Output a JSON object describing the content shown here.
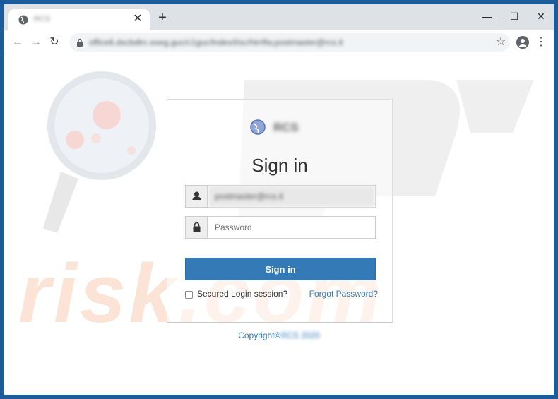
{
  "browser": {
    "tab_title": "RCS",
    "new_tab_label": "+",
    "tab_close_label": "✕",
    "url": "office6.dscbdlrc.exeg.guc/c1guc/lndex/l/sc/htrrlfw,postmaster@rcs.it",
    "controls": {
      "minimize": "—",
      "maximize": "☐",
      "close": "✕"
    },
    "back_label": "←",
    "forward_label": "→",
    "reload_label": "↻",
    "star_label": "☆",
    "menu_label": "⋮"
  },
  "login": {
    "brand": "RCS",
    "title": "Sign in",
    "email_value": "postmaster@rcs.it",
    "password_placeholder": "Password",
    "submit_label": "Sign in",
    "remember_label": "Secured Login session?",
    "forgot_label": "Forgot Password?",
    "copyright_prefix": "Copyright©",
    "copyright_name": "RCS 2020"
  },
  "watermark": {
    "text": "risk.com",
    "logo": "pc"
  },
  "colors": {
    "accent": "#337ab7",
    "frame": "#1d5c9a",
    "tabbar": "#dee1e6"
  }
}
